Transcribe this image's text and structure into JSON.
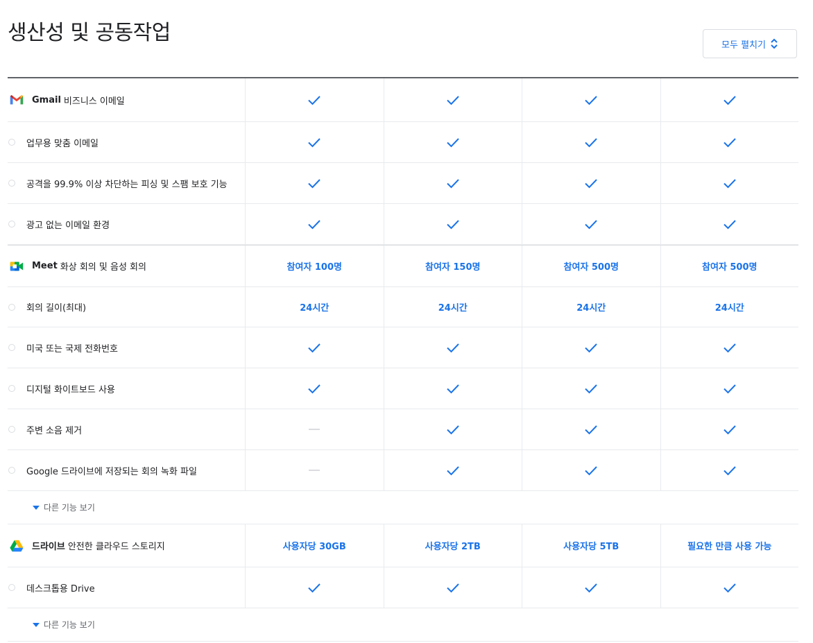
{
  "page": {
    "title": "생산성 및 공동작업",
    "expand_all_label": "모두 펼치기"
  },
  "sections": {
    "gmail": {
      "product_name": "Gmail",
      "product_desc": "비즈니스 이메일",
      "icon": "gmail-icon",
      "header_values": [
        "check",
        "check",
        "check",
        "check"
      ],
      "rows": [
        {
          "label": "업무용 맞춤 이메일",
          "values": [
            "check",
            "check",
            "check",
            "check"
          ]
        },
        {
          "label": "공격을 99.9% 이상 차단하는 피싱 및 스팸 보호 기능",
          "values": [
            "check",
            "check",
            "check",
            "check"
          ]
        },
        {
          "label": "광고 없는 이메일 환경",
          "values": [
            "check",
            "check",
            "check",
            "check"
          ]
        }
      ]
    },
    "meet": {
      "product_name": "Meet",
      "product_desc": "화상 회의 및 음성 회의",
      "icon": "meet-icon",
      "header_values": [
        "참여자 100명",
        "참여자 150명",
        "참여자 500명",
        "참여자 500명"
      ],
      "rows": [
        {
          "label": "회의 길이(최대)",
          "values": [
            "24시간",
            "24시간",
            "24시간",
            "24시간"
          ]
        },
        {
          "label": "미국 또는 국제 전화번호",
          "values": [
            "check",
            "check",
            "check",
            "check"
          ]
        },
        {
          "label": "디지털 화이트보드 사용",
          "values": [
            "check",
            "check",
            "check",
            "check"
          ]
        },
        {
          "label": "주변 소음 제거",
          "values": [
            "dash",
            "check",
            "check",
            "check"
          ]
        },
        {
          "label": "Google 드라이브에 저장되는 회의 녹화 파일",
          "values": [
            "dash",
            "check",
            "check",
            "check"
          ]
        }
      ],
      "more_label": "다른 기능 보기"
    },
    "drive": {
      "product_name": "드라이브",
      "product_desc": "안전한 클라우드 스토리지",
      "icon": "drive-icon",
      "header_values": [
        "사용자당 30GB",
        "사용자당 2TB",
        "사용자당 5TB",
        "필요한 만큼 사용 가능"
      ],
      "rows": [
        {
          "label": "데스크톱용 Drive",
          "values": [
            "check",
            "check",
            "check",
            "check"
          ]
        }
      ],
      "more_label": "다른 기능 보기"
    }
  },
  "colors": {
    "accent": "#1a73e8",
    "text": "#202124",
    "muted": "#5f6368",
    "divider": "#e8eaed",
    "dash": "#dadce0"
  }
}
